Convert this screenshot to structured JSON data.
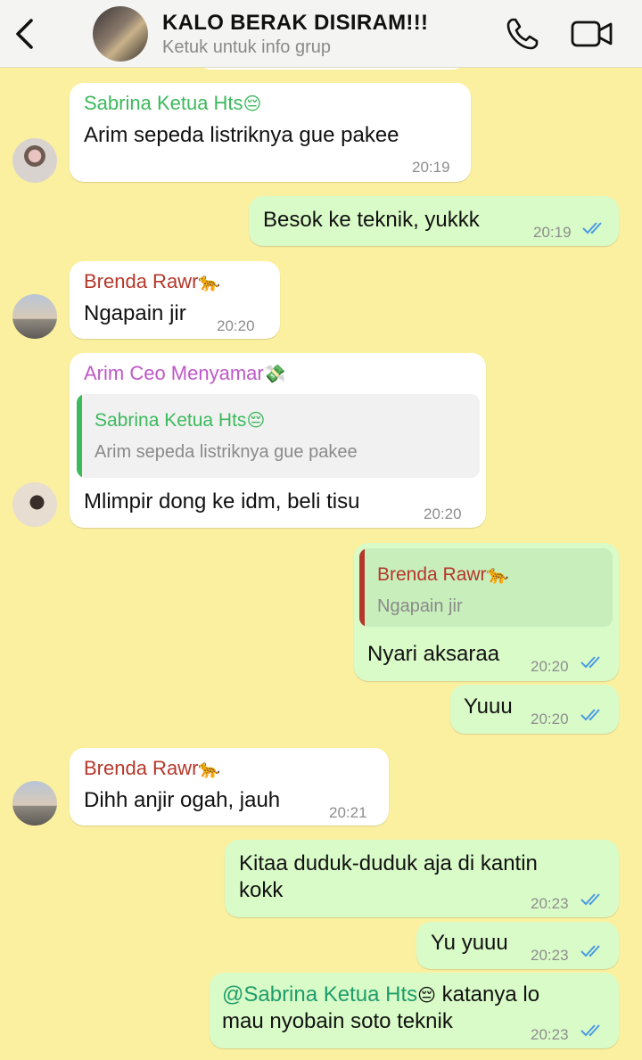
{
  "header": {
    "title": "KALO BERAK DISIRAM!!!",
    "subtitle": "Ketuk untuk info grup"
  },
  "colors": {
    "background": "#fbf0a0",
    "incoming_bubble": "#ffffff",
    "outgoing_bubble": "#d9fbc8",
    "sabrina": "#3cb95c",
    "brenda": "#b5372a",
    "arim": "#c057c9",
    "read_ticks": "#4b9be3"
  },
  "messages": [
    {
      "sender": "Sabrina Ketua Hts",
      "sender_emoji": "😔",
      "text": "Arim sepeda listriknya gue pakee",
      "time": "20:19"
    },
    {
      "text": "Besok ke teknik, yukkk",
      "time": "20:19",
      "status": "read"
    },
    {
      "sender": "Brenda Rawr",
      "sender_emoji": "🐆",
      "text": "Ngapain jir",
      "time": "20:20"
    },
    {
      "sender": "Arim Ceo Menyamar",
      "sender_emoji": "💸",
      "reply": {
        "sender": "Sabrina Ketua Hts",
        "sender_emoji": "😔",
        "text": "Arim sepeda listriknya gue pakee"
      },
      "text": "Mlimpir dong ke idm, beli tisu",
      "time": "20:20"
    },
    {
      "reply": {
        "sender": "Brenda Rawr",
        "sender_emoji": "🐆",
        "text": "Ngapain jir"
      },
      "text": "Nyari aksaraa",
      "time": "20:20",
      "status": "read"
    },
    {
      "text": "Yuuu",
      "time": "20:20",
      "status": "read"
    },
    {
      "sender": "Brenda Rawr",
      "sender_emoji": "🐆",
      "text": "Dihh anjir ogah, jauh",
      "time": "20:21"
    },
    {
      "text_line1": "Kitaa duduk-duduk aja di kantin",
      "text_line2": "kokk",
      "time": "20:23",
      "status": "read"
    },
    {
      "text": "Yu yuuu",
      "time": "20:23",
      "status": "read"
    },
    {
      "mention": "@Sabrina Ketua Hts",
      "mention_emoji": "😔",
      "text_line1_rest": " katanya lo",
      "text_line2": "mau nyobain soto teknik",
      "time": "20:23",
      "status": "read"
    }
  ]
}
